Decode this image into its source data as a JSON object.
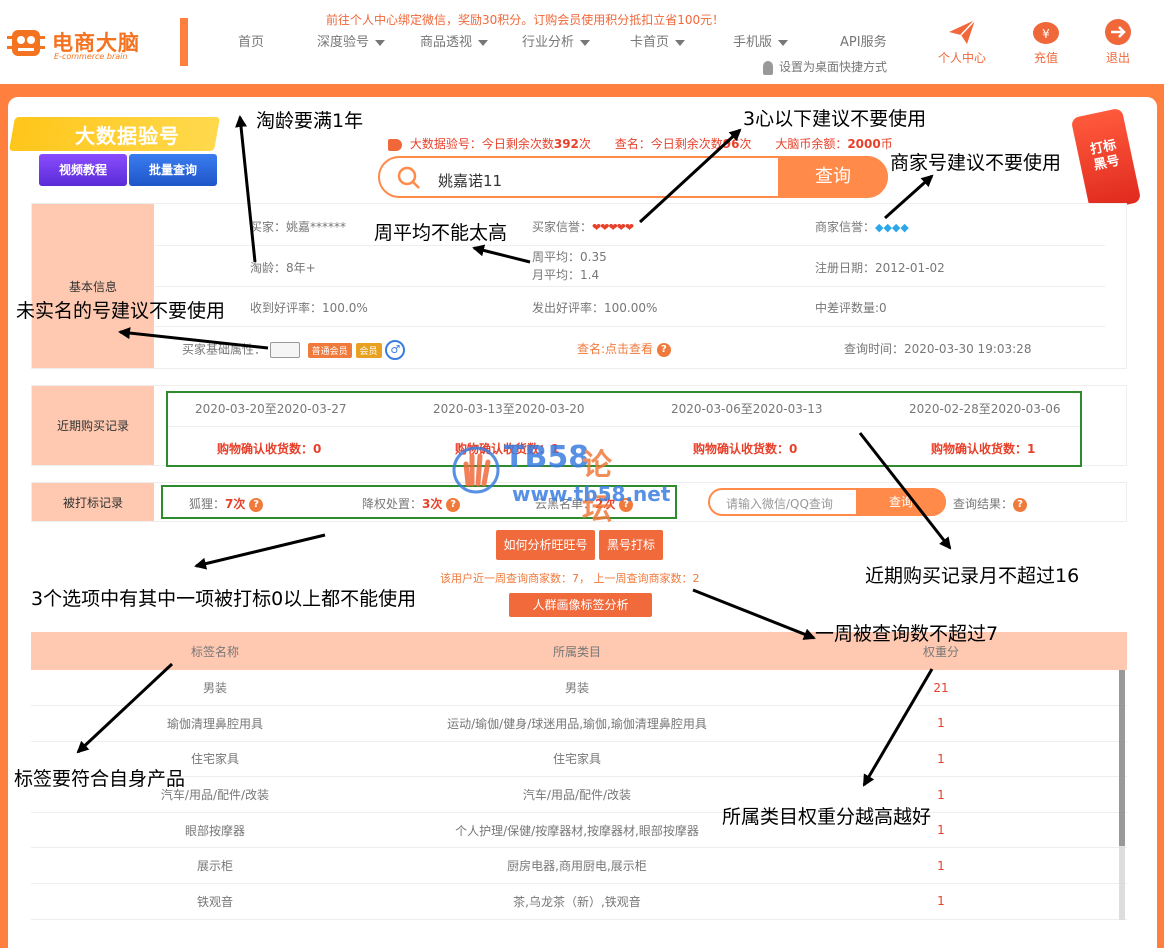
{
  "header": {
    "logo_cn": "电商大脑",
    "logo_en": "E-commerce brain",
    "promo": "前往个人中心绑定微信，奖励30积分。订购会员使用积分抵扣立省100元！",
    "nav": [
      {
        "label": "首页",
        "dropdown": false
      },
      {
        "label": "深度验号",
        "dropdown": true
      },
      {
        "label": "商品透视",
        "dropdown": true
      },
      {
        "label": "行业分析",
        "dropdown": true
      },
      {
        "label": "卡首页",
        "dropdown": true
      },
      {
        "label": "手机版",
        "dropdown": true
      },
      {
        "label": "API服务",
        "dropdown": false
      }
    ],
    "shortcut": "设置为桌面快捷方式",
    "icons": [
      {
        "label": "个人中心",
        "icon": "paper-plane-icon"
      },
      {
        "label": "充值",
        "icon": "piggy-bank-icon"
      },
      {
        "label": "退出",
        "icon": "exit-arrow-icon"
      }
    ]
  },
  "brand": {
    "title": "大数据验号",
    "video_btn": "视频教程",
    "batch_btn": "批量查询"
  },
  "counters": {
    "verify_label": "大数据验号：今日剩余次数",
    "verify_count": "392",
    "verify_unit": "次",
    "check_label": "查名：今日剩余次数",
    "check_count": "96",
    "check_unit": "次",
    "coins_label": "大脑币余额：",
    "coins_value": "2000",
    "coins_unit": "币"
  },
  "search": {
    "value": "姚嘉诺11",
    "button": "查询"
  },
  "hang_tag": "打标黑号",
  "basic": {
    "label": "基本信息",
    "buyer": "买家：姚嘉******",
    "buyer_credit_label": "买家信誉：",
    "seller_credit_label": "商家信誉：",
    "age": "淘龄：8年+",
    "weekly_avg": "周平均：0.35",
    "monthly_avg": "月平均：1.4",
    "reg_date": "注册日期：2012-01-02",
    "good_rate_received": "收到好评率：100.0%",
    "good_rate_sent": "发出好评率：100.00%",
    "bad_count": "中差评数量:0",
    "attr_label": "买家基础属性：",
    "member_badge": "普通会员",
    "vip_badge": "会员",
    "check_name": "查名:点击查看",
    "query_time": "查询时间：2020-03-30 19:03:28"
  },
  "purchases": {
    "label": "近期购买记录",
    "ranges": [
      "2020-03-20至2020-03-27",
      "2020-03-13至2020-03-20",
      "2020-03-06至2020-03-13",
      "2020-02-28至2020-03-06"
    ],
    "confirm_label": "购物确认收货数：",
    "counts": [
      "0",
      "1",
      "0",
      "1"
    ]
  },
  "marks": {
    "label": "被打标记录",
    "fox_label": "狐狸：",
    "fox_value": "7次",
    "demote_label": "降权处置：",
    "demote_value": "3次",
    "blacklist_label": "云黑名单：",
    "blacklist_value": "2次",
    "input_placeholder": "请输入微信/QQ查询",
    "query_btn": "查询",
    "result_label": "查询结果："
  },
  "actions": {
    "analyze_btn": "如何分析旺旺号",
    "black_btn": "黑号打标",
    "week_info": "该用户近一周查询商家数：7， 上一周查询商家数：2",
    "crowd_btn": "人群画像标签分析"
  },
  "tags_table": {
    "headers": [
      "标签名称",
      "所属类目",
      "权重分"
    ],
    "rows": [
      [
        "男装",
        "男装",
        "21"
      ],
      [
        "瑜伽清理鼻腔用具",
        "运动/瑜伽/健身/球迷用品,瑜伽,瑜伽清理鼻腔用具",
        "1"
      ],
      [
        "住宅家具",
        "住宅家具",
        "1"
      ],
      [
        "汽车/用品/配件/改装",
        "汽车/用品/配件/改装",
        "1"
      ],
      [
        "眼部按摩器",
        "个人护理/保健/按摩器材,按摩器材,眼部按摩器",
        "1"
      ],
      [
        "展示柜",
        "厨房电器,商用厨电,展示柜",
        "1"
      ],
      [
        "铁观音",
        "茶,乌龙茶（新）,铁观音",
        "1"
      ]
    ]
  },
  "watermark": {
    "tb": "TB58",
    "lt": "论坛",
    "url": "www.tb58.net"
  },
  "annotations": {
    "age": "淘龄要满1年",
    "three_hearts": "3心以下建议不要使用",
    "merchant": "商家号建议不要使用",
    "weekly": "周平均不能太高",
    "realname": "未实名的号建议不要使用",
    "purchase": "近期购买记录月不超过16",
    "marked": "3个选项中有其中一项被打标0以上都不能使用",
    "week_query": "一周被查询数不超过7",
    "tags": "标签要符合自身产品",
    "category": "所属类目权重分越高越好"
  },
  "colors": {
    "accent": "#ff7f3f",
    "panel_label": "#ffc8b0",
    "red": "#e8412b",
    "green_box": "#2e8b2e"
  }
}
